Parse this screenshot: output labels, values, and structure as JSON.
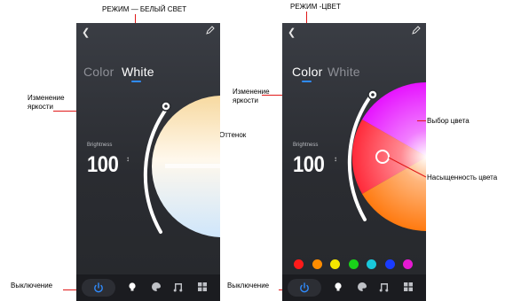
{
  "captions": {
    "mode_white": "РЕЖИМ — БЕЛЫЙ СВЕТ",
    "mode_color": "РЕЖИМ -ЦВЕТ",
    "brightness_change_1": "Изменение яркости",
    "brightness_change_2": "Изменение яркости",
    "hue": "Оттенок",
    "color_select": "Выбор цвета",
    "saturation": "Насыщенность цвета",
    "power_off_1": "Выключение",
    "power_off_2": "Выключение"
  },
  "white_screen": {
    "tab_color": "Color",
    "tab_white": "White",
    "active_tab": "White",
    "brightness_label": "Brightness",
    "brightness_value": "100",
    "brightness_arrow": "↕"
  },
  "color_screen": {
    "tab_color": "Color",
    "tab_white": "White",
    "active_tab": "Color",
    "brightness_label": "Brightness",
    "brightness_value": "100",
    "brightness_arrow": "↕",
    "preset_colors": [
      "#ff1a1a",
      "#ff8c00",
      "#f5e600",
      "#19d219",
      "#19c8dc",
      "#1a3cff",
      "#e619d2"
    ]
  },
  "icons": {
    "back": "chevron-left-icon",
    "edit": "pencil-icon",
    "power": "power-icon",
    "bulb": "bulb-icon",
    "palette": "palette-icon",
    "music": "music-icon",
    "grid": "grid-icon"
  },
  "colors": {
    "accent": "#2f8cff",
    "callout": "#e01818"
  }
}
